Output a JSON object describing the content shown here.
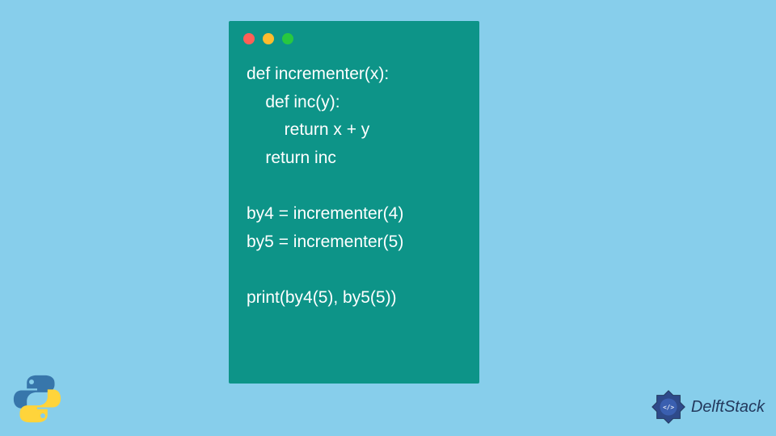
{
  "code": {
    "lines": [
      "def incrementer(x):",
      "    def inc(y):",
      "        return x + y",
      "    return inc",
      "",
      "by4 = incrementer(4)",
      "by5 = incrementer(5)",
      "",
      "print(by4(5), by5(5))"
    ]
  },
  "brand": {
    "name": "DelftStack"
  },
  "window_controls": {
    "colors": [
      "#ff5f57",
      "#febc2e",
      "#28c840"
    ]
  }
}
